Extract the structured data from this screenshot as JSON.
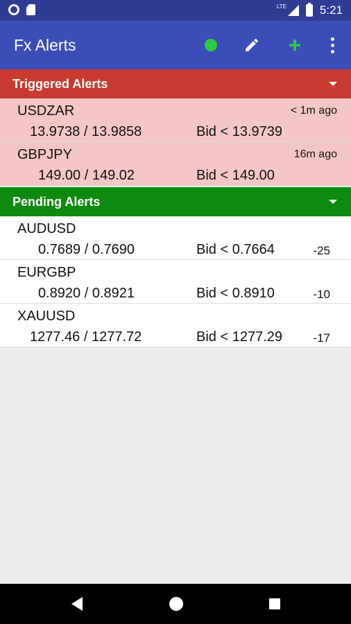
{
  "status_bar": {
    "time": "5:21",
    "network": "LTE"
  },
  "app_bar": {
    "title": "Fx Alerts",
    "actions": [
      "connection-status",
      "edit",
      "add",
      "more-options"
    ]
  },
  "triggered": {
    "title": "Triggered Alerts",
    "items": [
      {
        "symbol": "USDZAR",
        "prices": "13.9738  /  13.9858",
        "condition": "Bid < 13.9739",
        "time": "< 1m ago"
      },
      {
        "symbol": "GBPJPY",
        "prices": "149.00  /  149.02",
        "condition": "Bid < 149.00",
        "time": "16m ago"
      }
    ]
  },
  "pending": {
    "title": "Pending Alerts",
    "items": [
      {
        "symbol": "AUDUSD",
        "prices": "0.7689  /  0.7690",
        "condition": "Bid < 0.7664",
        "diff": "-25"
      },
      {
        "symbol": "EURGBP",
        "prices": "0.8920  /  0.8921",
        "condition": "Bid < 0.8910",
        "diff": "-10"
      },
      {
        "symbol": "XAUUSD",
        "prices": "1277.46  /  1277.72",
        "condition": "Bid < 1277.29",
        "diff": "-17"
      }
    ]
  },
  "colors": {
    "status_bar": "#2e3c94",
    "app_bar": "#3b4eb8",
    "triggered_header": "#c93a30",
    "triggered_row": "#f5c6c6",
    "pending_header": "#0e8a0e",
    "status_dot": "#2ecc40"
  }
}
